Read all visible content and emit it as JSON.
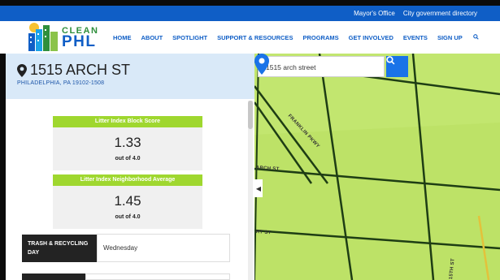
{
  "topbar": {
    "links": [
      "Mayor's Office",
      "City government directory"
    ]
  },
  "logo": {
    "line1": "CLEAN",
    "line2": "PHL"
  },
  "nav": {
    "items": [
      "HOME",
      "ABOUT",
      "SPOTLIGHT",
      "SUPPORT & RESOURCES",
      "PROGRAMS",
      "GET INVOLVED",
      "EVENTS",
      "SIGN UP"
    ],
    "search_icon": "search-icon"
  },
  "address": {
    "title": "1515 ARCH ST",
    "subtitle": "PHILADELPHIA, PA 19102-1508"
  },
  "scores": [
    {
      "label": "Litter Index Block Score",
      "value": "1.33",
      "suffix": "out of 4.0"
    },
    {
      "label": "Litter Index Neighborhood Average",
      "value": "1.45",
      "suffix": "out of 4.0"
    }
  ],
  "schedule": {
    "rows": [
      {
        "label": "TRASH & RECYCLING DAY",
        "value": "Wednesday"
      }
    ]
  },
  "map": {
    "search_value": "1515 arch street",
    "streets": [
      "FRANKLIN PKWY",
      "ARCH ST",
      "RT ST",
      "15TH ST"
    ],
    "colors": {
      "area": "#c2e66f",
      "road": "#1e3d14",
      "accent": "#1a73e8"
    }
  },
  "colors": {
    "brand_blue": "#0f5ec6",
    "score_green": "#9fd72f"
  }
}
